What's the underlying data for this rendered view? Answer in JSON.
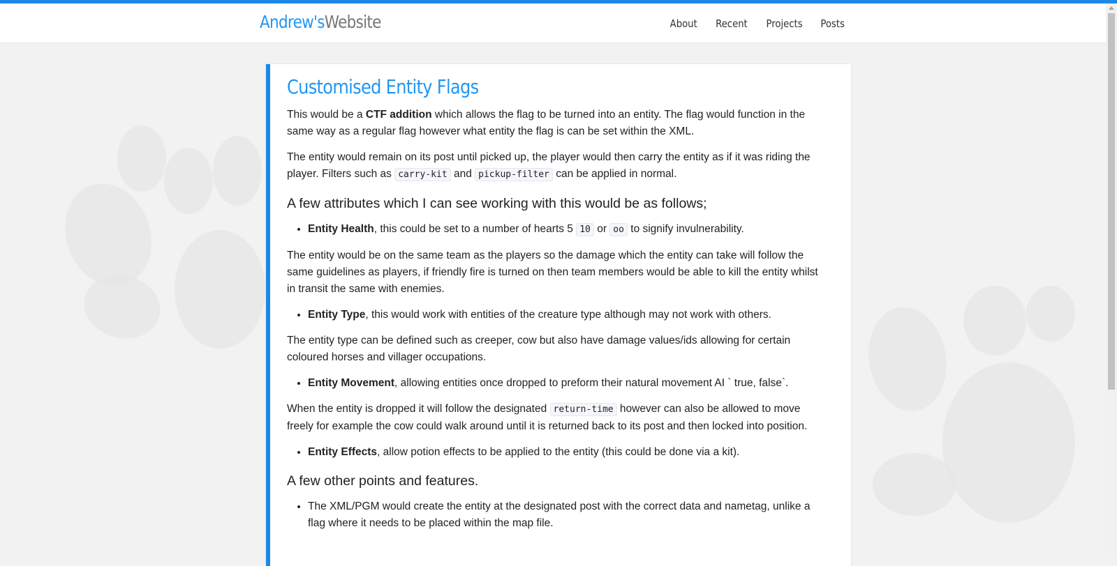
{
  "header": {
    "brand_part1": "Andrew's",
    "brand_part2": "Website",
    "nav": [
      "About",
      "Recent",
      "Projects",
      "Posts"
    ]
  },
  "article": {
    "title": "Customised Entity Flags",
    "p1": {
      "before": "This would be a ",
      "strong": "CTF addition",
      "after": " which allows the flag to be turned into an entity. The flag would function in the same way as a regular flag however what entity the flag is can be set within the XML."
    },
    "p2": {
      "before": "The entity would remain on its post until picked up, the player would then carry the entity as if it was riding the player. Filters such as ",
      "code1": "carry-kit",
      "mid": " and ",
      "code2": "pickup-filter",
      "after": " can be applied in normal."
    },
    "h_attributes": "A few attributes which I can see working with this would be as follows;",
    "item_health": {
      "strong": "Entity Health",
      "text1": ", this could be set to a number of hearts 5 ",
      "code1": "10",
      "mid": " or ",
      "code2": "oo",
      "after": " to signify invulnerability."
    },
    "p3": "The entity would be on the same team as the players so the damage which the entity can take will follow the same guidelines as players, if friendly fire is turned on then team members would be able to kill the entity whilst in transit the same with enemies.",
    "item_type": {
      "strong": "Entity Type",
      "text": ", this would work with entities of the creature type although may not work with others."
    },
    "p4": "The entity type can be defined such as creeper, cow but also have damage values/ids allowing for certain coloured horses and villager occupations.",
    "item_movement": {
      "strong": "Entity Movement",
      "text": ", allowing entities once dropped to preform their natural movement AI ` true, false`."
    },
    "p5": {
      "before": "When the entity is dropped it will follow the designated ",
      "code": "return-time",
      "after": " however can also be allowed to move freely for example the cow could walk around until it is returned back to its post and then locked into position."
    },
    "item_effects": {
      "strong": "Entity Effects",
      "text": ", allow potion effects to be applied to the entity (this could be done via a kit)."
    },
    "h_other": "A few other points and features.",
    "item_xml": "The XML/PGM would create the entity at the designated post with the correct data and nametag, unlike a flag where it needs to be placed within the map file."
  },
  "colors": {
    "accent": "#1e88e5",
    "link": "#2196f3",
    "background": "#f2f2f2"
  }
}
